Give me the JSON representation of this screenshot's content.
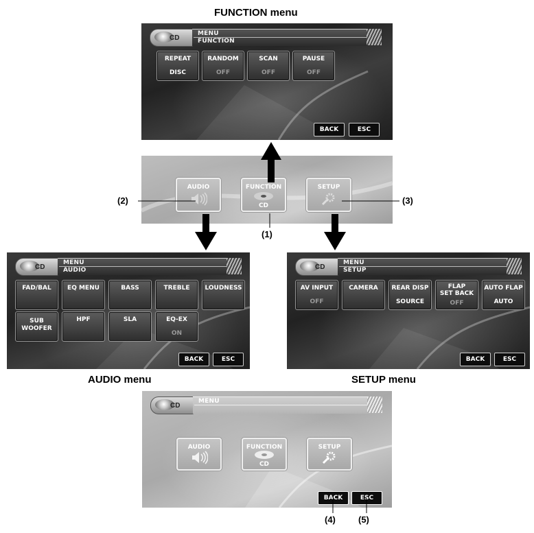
{
  "captions": {
    "function_menu": "FUNCTION menu",
    "audio_menu": "AUDIO menu",
    "setup_menu": "SETUP menu"
  },
  "callouts": [
    "(1)",
    "(2)",
    "(3)",
    "(4)",
    "(5)"
  ],
  "function_screen": {
    "menu_title": "MENU",
    "subtitle": "FUNCTION",
    "cd_logo": "CD",
    "tiles": [
      {
        "label": "REPEAT",
        "value": "DISC"
      },
      {
        "label": "RANDOM",
        "value": "OFF"
      },
      {
        "label": "SCAN",
        "value": "OFF"
      },
      {
        "label": "PAUSE",
        "value": "OFF"
      }
    ],
    "back": "BACK",
    "esc": "ESC"
  },
  "main_screen": {
    "buttons": [
      {
        "label": "AUDIO",
        "icon": "speaker-icon"
      },
      {
        "label": "FUNCTION",
        "icon": "cd-icon",
        "sub": "CD"
      },
      {
        "label": "SETUP",
        "icon": "wrench-gear-icon"
      }
    ]
  },
  "audio_screen": {
    "menu_title": "MENU",
    "subtitle": "AUDIO",
    "cd_logo": "CD",
    "tiles": [
      {
        "label": "FAD/BAL",
        "value": ""
      },
      {
        "label": "EQ MENU",
        "value": ""
      },
      {
        "label": "BASS",
        "value": ""
      },
      {
        "label": "TREBLE",
        "value": ""
      },
      {
        "label": "LOUDNESS",
        "value": ""
      },
      {
        "label": "SUB\nWOOFER",
        "value": ""
      },
      {
        "label": "HPF",
        "value": ""
      },
      {
        "label": "SLA",
        "value": ""
      },
      {
        "label": "EQ-EX",
        "value": "ON"
      }
    ],
    "back": "BACK",
    "esc": "ESC"
  },
  "setup_screen": {
    "menu_title": "MENU",
    "subtitle": "SETUP",
    "cd_logo": "CD",
    "tiles": [
      {
        "label": "AV INPUT",
        "value": "OFF"
      },
      {
        "label": "CAMERA",
        "value": ""
      },
      {
        "label": "REAR DISP",
        "value": "SOURCE"
      },
      {
        "label": "FLAP\nSET BACK",
        "value": "OFF"
      },
      {
        "label": "AUTO FLAP",
        "value": "AUTO"
      }
    ],
    "back": "BACK",
    "esc": "ESC"
  },
  "bottom_screen": {
    "menu_title": "MENU",
    "cd_logo": "CD",
    "buttons": [
      {
        "label": "AUDIO",
        "icon": "speaker-icon"
      },
      {
        "label": "FUNCTION",
        "icon": "cd-icon",
        "sub": "CD"
      },
      {
        "label": "SETUP",
        "icon": "wrench-gear-icon"
      }
    ],
    "back": "BACK",
    "esc": "ESC"
  }
}
